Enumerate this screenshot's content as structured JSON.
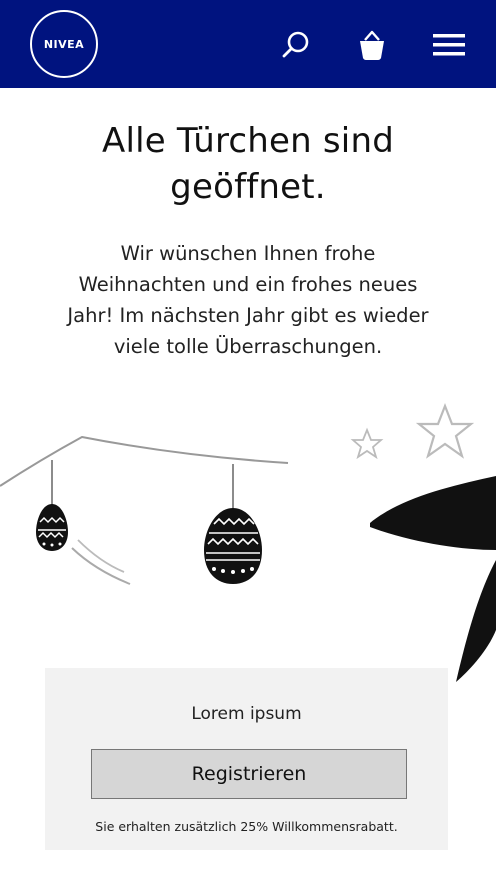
{
  "header": {
    "logo_text": "NIVEA",
    "background_color": "#00137f",
    "icons": [
      "search-icon",
      "shopping-basket-icon",
      "hamburger-menu-icon"
    ]
  },
  "main": {
    "title": "Alle Türchen sind geöffnet.",
    "message": "Wir wünschen Ihnen frohe Weihnachten und ein frohes neues Jahr! Im nächsten Jahr gibt es wieder viele tolle Überraschungen."
  },
  "register_panel": {
    "label": "Lorem ipsum",
    "button_label": "Registrieren",
    "note": "Sie erhalten zusätzlich 25% Willkommensrabatt."
  }
}
